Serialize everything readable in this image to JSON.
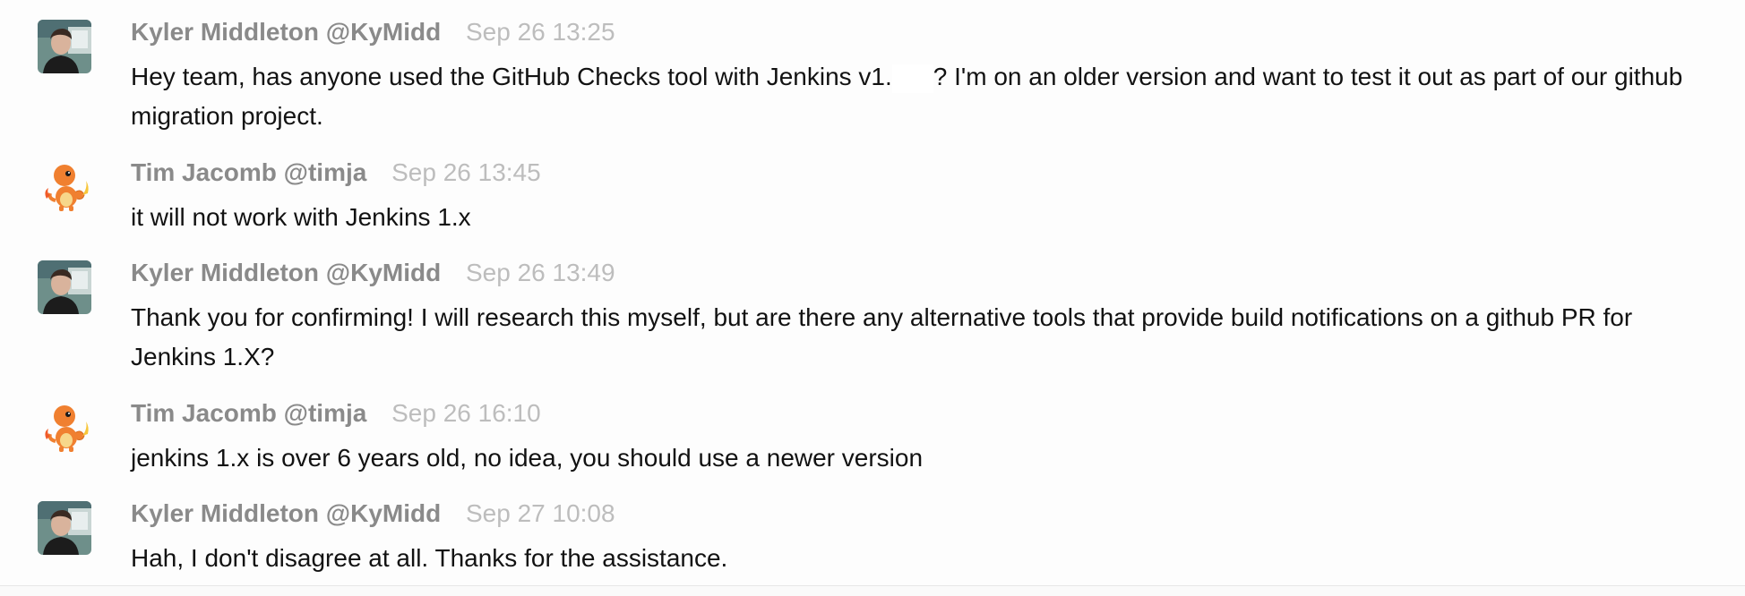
{
  "messages": [
    {
      "author": "Kyler Middleton",
      "handle": "@KyMidd",
      "timestamp": "Sep 26 13:25",
      "text_before": "Hey team, has anyone used the GitHub Checks tool with Jenkins v1.",
      "text_after": "? I'm on an older version and want to test it out as part of our github migration project."
    },
    {
      "author": "Tim Jacomb",
      "handle": "@timja",
      "timestamp": "Sep 26 13:45",
      "text": "it will not work with Jenkins 1.x"
    },
    {
      "author": "Kyler Middleton",
      "handle": "@KyMidd",
      "timestamp": "Sep 26 13:49",
      "text": "Thank you for confirming! I will research this myself, but are there any alternative tools that provide build notifications on a github PR for Jenkins 1.X?"
    },
    {
      "author": "Tim Jacomb",
      "handle": "@timja",
      "timestamp": "Sep 26 16:10",
      "text": "jenkins 1.x is over 6 years old, no idea, you should use a newer version"
    },
    {
      "author": "Kyler Middleton",
      "handle": "@KyMidd",
      "timestamp": "Sep 27 10:08",
      "text": "Hah, I don't disagree at all. Thanks for the assistance."
    }
  ],
  "icons": {
    "kyler_avatar": "user-photo-avatar",
    "tim_avatar": "charmander-avatar"
  },
  "colors": {
    "author": "#8a8a8a",
    "timestamp": "#bdbdbd",
    "message_text": "#121212",
    "background": "#fdfdfd"
  }
}
